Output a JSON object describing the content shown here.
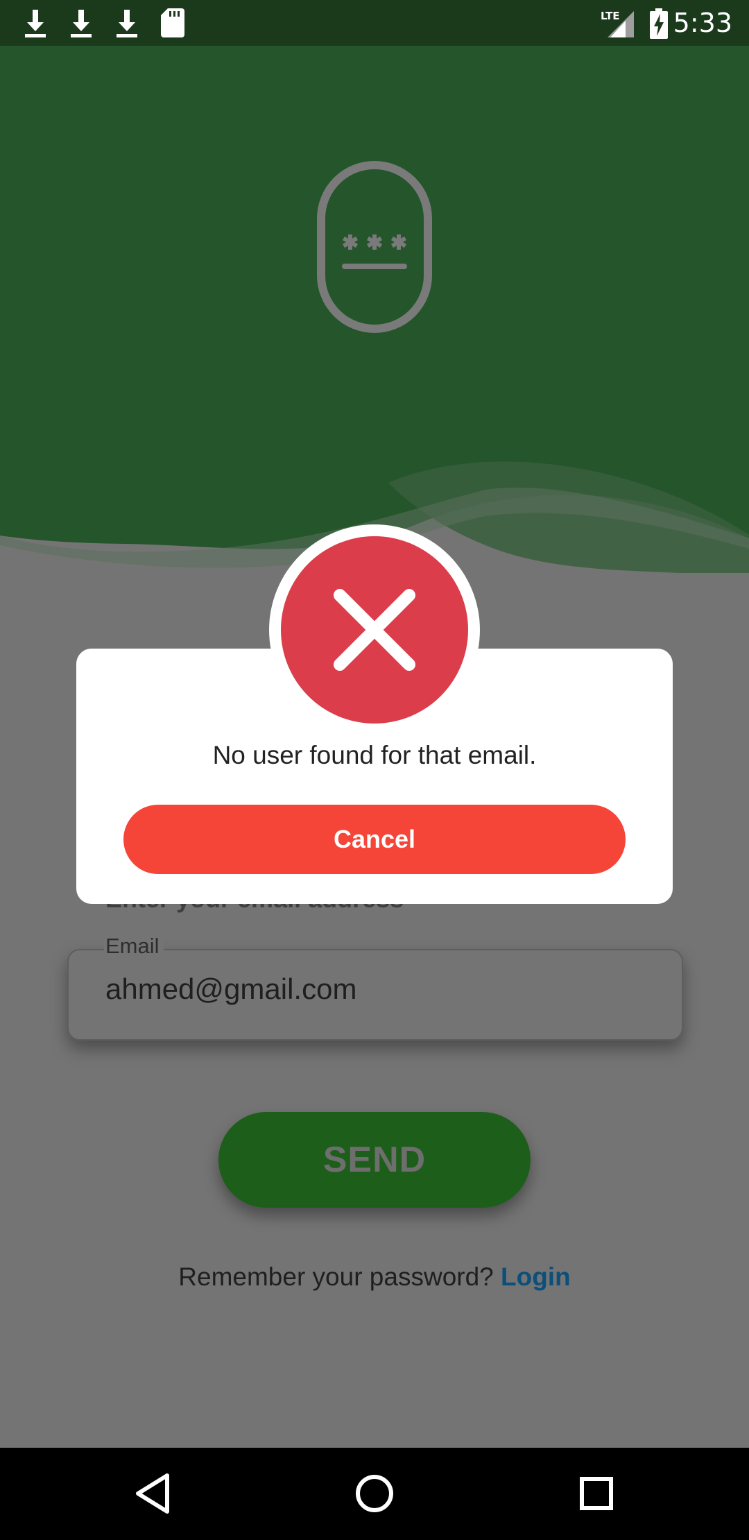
{
  "status_bar": {
    "time": "5:33",
    "network": "LTE",
    "icons": [
      "download-icon",
      "download-icon",
      "download-icon",
      "sd-card-icon",
      "lte-signal-icon",
      "battery-charging-icon"
    ]
  },
  "header": {
    "icon": "password-lock-icon",
    "background_color": "#25552a"
  },
  "form": {
    "subtitle": "Enter your email address",
    "email_label": "Email",
    "email_value": "ahmed@gmail.com",
    "send_label": "SEND",
    "remember_text": "Remember your password?",
    "login_label": "Login"
  },
  "dialog": {
    "icon": "error-x-icon",
    "message": "No user found for that email.",
    "cancel_label": "Cancel",
    "accent_color": "#f54538",
    "icon_color": "#db3d4a"
  },
  "nav_bar": {
    "buttons": [
      "back-icon",
      "home-icon",
      "recents-icon"
    ]
  },
  "colors": {
    "overlay": "#747474",
    "link": "#0c4f7a",
    "send_button": "#1e5e1b"
  }
}
